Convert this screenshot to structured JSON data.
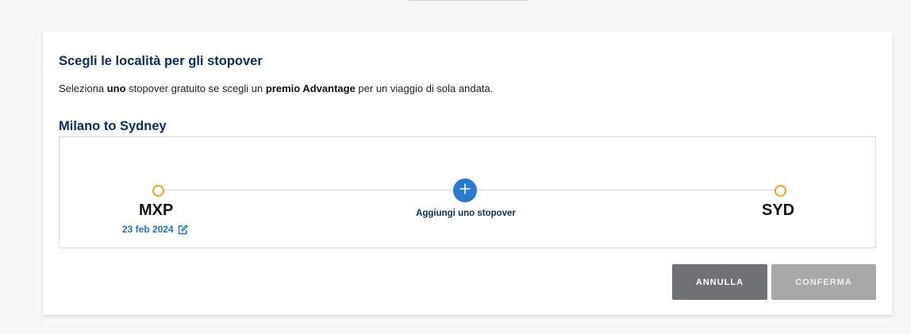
{
  "panel": {
    "title": "Scegli le località per gli stopover",
    "description": {
      "part1": "Seleziona ",
      "bold1": "uno",
      "part2": " stopover gratuito se scegli un ",
      "bold2": "premio Advantage",
      "part3": " per un viaggio di sola andata."
    }
  },
  "route": {
    "title": "Milano to Sydney",
    "origin": {
      "code": "MXP",
      "date": "23 feb 2024",
      "icon": "edit-icon"
    },
    "destination": {
      "code": "SYD"
    },
    "add_stopover": {
      "label": "Aggiungi uno stopover",
      "icon": "plus-icon"
    }
  },
  "actions": {
    "cancel_label": "ANNULLA",
    "confirm_label": "CONFERMA"
  },
  "colors": {
    "title": "#0b2d63",
    "accent_blue": "#2a7ad2",
    "node_orange": "#f2a51a",
    "cancel_bg": "#6f7378",
    "confirm_bg_disabled": "#a8a8a8"
  }
}
